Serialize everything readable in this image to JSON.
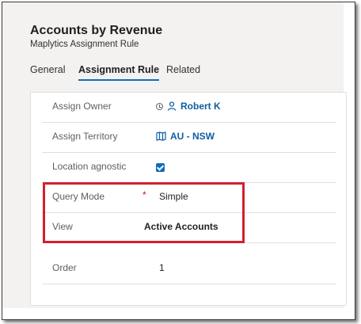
{
  "header": {
    "title": "Accounts by Revenue",
    "subtitle": "Maplytics Assignment Rule"
  },
  "tabs": [
    {
      "label": "General",
      "active": false
    },
    {
      "label": "Assignment Rule",
      "active": true
    },
    {
      "label": "Related",
      "active": false
    }
  ],
  "form": {
    "assign_owner": {
      "label": "Assign Owner",
      "value": "Robert K"
    },
    "assign_territory": {
      "label": "Assign Territory",
      "value": "AU - NSW"
    },
    "location_agnostic": {
      "label": "Location agnostic",
      "checked": true
    },
    "query_mode": {
      "label": "Query Mode",
      "required_marker": "*",
      "value": "Simple"
    },
    "view": {
      "label": "View",
      "value": "Active Accounts"
    },
    "order": {
      "label": "Order",
      "value": "1"
    }
  },
  "colors": {
    "accent": "#0f6cbd",
    "link": "#115ea3",
    "highlight": "#d3202e",
    "required": "#c50f1f"
  }
}
